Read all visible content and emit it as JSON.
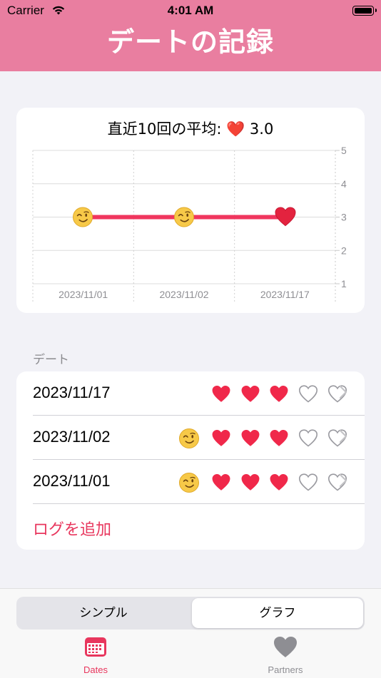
{
  "status_bar": {
    "carrier": "Carrier",
    "time": "4:01 AM"
  },
  "header": {
    "title": "デートの記録"
  },
  "chart_card": {
    "title": "直近10回の平均: ❤️ 3.0",
    "accent_color": "#f0365e"
  },
  "chart_data": {
    "type": "line",
    "title": "直近10回の平均: ❤️ 3.0",
    "categories": [
      "2023/11/01",
      "2023/11/02",
      "2023/11/17"
    ],
    "series": [
      {
        "values": [
          3,
          3,
          3
        ]
      }
    ],
    "point_markers": [
      "wink-emoji",
      "wink-emoji",
      "heart"
    ],
    "ylim": [
      1,
      5
    ],
    "y_ticks": [
      "5",
      "4",
      "3",
      "2",
      "1"
    ],
    "y_axis_position": "right",
    "grid": true
  },
  "list": {
    "section_label": "デート",
    "rows": [
      {
        "date": "2023/11/17",
        "has_emoji": false,
        "rating": 3,
        "max": 5
      },
      {
        "date": "2023/11/02",
        "has_emoji": true,
        "rating": 3,
        "max": 5
      },
      {
        "date": "2023/11/01",
        "has_emoji": true,
        "rating": 3,
        "max": 5
      }
    ],
    "add_label": "ログを追加"
  },
  "segmented_control": {
    "options": [
      "シンプル",
      "グラフ"
    ],
    "selected": "グラフ"
  },
  "tab_bar": {
    "tabs": [
      {
        "label": "Dates",
        "icon": "calendar-icon",
        "active": true
      },
      {
        "label": "Partners",
        "icon": "heart-icon",
        "active": false
      }
    ],
    "active_color": "#e8365d",
    "inactive_color": "#8e8e93"
  }
}
